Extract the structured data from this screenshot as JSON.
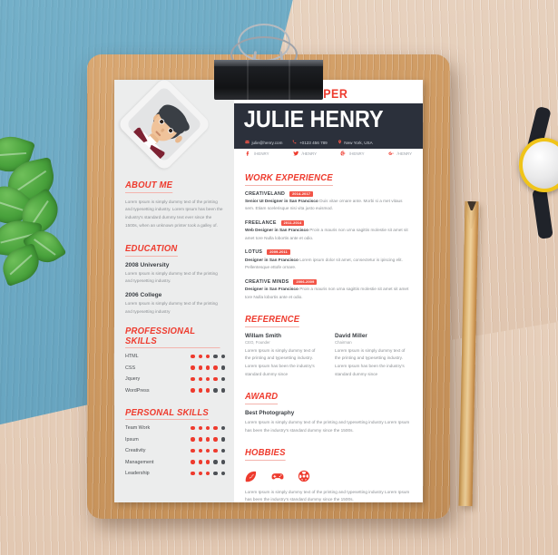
{
  "scene": {
    "background": "blue painted wood and light wood desk",
    "colors": {
      "accent": "#ee3b2e",
      "dark": "#2b303b",
      "paper": "#ffffff",
      "sidebar": "#eceded",
      "clipboard": "#cf9b63",
      "blue": "#6aa7c2",
      "wood": "#e3cab5"
    },
    "props": [
      "binder-clip",
      "pencil",
      "mint-leaves",
      "wristwatch"
    ]
  },
  "resume": {
    "role": "WEB DEVELOPER",
    "name": "JULIE HENRY",
    "contacts": [
      {
        "icon": "mail-icon",
        "text": "julie@henry.com"
      },
      {
        "icon": "phone-icon",
        "text": "+0123 456 789"
      },
      {
        "icon": "location-icon",
        "text": "New York, USA"
      }
    ],
    "socials": [
      {
        "icon": "facebook-icon",
        "glyph": "f",
        "handle": "/HENRY"
      },
      {
        "icon": "twitter-icon",
        "glyph": "t",
        "handle": "/HENRY"
      },
      {
        "icon": "pinterest-icon",
        "glyph": "p",
        "handle": "/HENRY"
      },
      {
        "icon": "google-plus-icon",
        "glyph": "G+",
        "handle": "/HENRY"
      }
    ],
    "about": {
      "heading": "ABOUT ME",
      "text": "Lorem Ipsum is simply dummy text of the printing and typesetting industry. Lorem Ipsum has been the industry's standard dummy text ever since the 1500s, when an unknown printer took a galley of."
    },
    "education": {
      "heading": "EDUCATION",
      "items": [
        {
          "title": "2008 University",
          "text": "Lorem Ipsum is simply dummy text of the printing and typesetting industry."
        },
        {
          "title": "2006 College",
          "text": "Lorem Ipsum is simply dummy text of the printing and typesetting industry"
        }
      ]
    },
    "professional_skills": {
      "heading": "PROFESSIONAL SKILLS",
      "max": 5,
      "items": [
        {
          "name": "HTML",
          "level": 3
        },
        {
          "name": "CSS",
          "level": 4
        },
        {
          "name": "Jquery",
          "level": 4
        },
        {
          "name": "WordPress",
          "level": 3
        }
      ]
    },
    "personal_skills": {
      "heading": "PERSONAL SKILLS",
      "max": 5,
      "items": [
        {
          "name": "Team Work",
          "level": 4
        },
        {
          "name": "Ipsum",
          "level": 4
        },
        {
          "name": "Creativity",
          "level": 4
        },
        {
          "name": "Management",
          "level": 3
        },
        {
          "name": "Leadership",
          "level": 3
        }
      ]
    },
    "work_experience": {
      "heading": "WORK EXPERIENCE",
      "jobs": [
        {
          "company": "CREATIVELAND",
          "date": "2014-2017",
          "role": "Senior UI Designer in San Francisco",
          "text": "Duis vitae ornare ante. Morbi si a met vitaus sem. Etiam scelerisque nisi vita justo euismod."
        },
        {
          "company": "FREELANCE",
          "date": "2011-2014",
          "role": "Web Designer in San Francisco",
          "text": "Proin a mauris non urna sagittis molestie sit amet sit amet tore Nulla lobortis ante et odio."
        },
        {
          "company": "LOTUS",
          "date": "2009-2011",
          "role": "Designer in San Francisco",
          "text": "Lorem ipsum dolor sit amet, consectetur is ipiscing elit. Pellentesque ettofe ornare."
        },
        {
          "company": "CREATIVE MINDS",
          "date": "2006-2009",
          "role": "Designer in San Francisco",
          "text": "Proin a mauris non urna sagittis molestie sit amet sit amet tore Nulla lobortis ante et odio."
        }
      ]
    },
    "reference": {
      "heading": "REFERENCE",
      "people": [
        {
          "name": "Willam Smith",
          "role": "CEO, Founder",
          "text": "Lorem Ipsum is simply dummy text of the printing and typesetting industry. Lorem Ipsum has been the industry's standard dummy since"
        },
        {
          "name": "David Miller",
          "role": "Chairman",
          "text": "Lorem Ipsum is simply dummy text of the printing and typesetting industry. Lorem Ipsum has been the industry's standard dummy since"
        }
      ]
    },
    "award": {
      "heading": "AWARD",
      "title": "Best Photography",
      "text": "Lorem Ipsum is simply dummy text of the printing and typesetting industry Lorem Ipsum has been the industry's standard dummy since the 1500s."
    },
    "hobbies": {
      "heading": "HOBBIES",
      "icons": [
        "football-icon",
        "gamepad-icon",
        "soccer-ball-icon"
      ],
      "text": "Lorem Ipsum is simply dummy text of the printing and typesetting industry Lorem Ipsum has been the industry's standard dummy since the 1500s."
    }
  }
}
